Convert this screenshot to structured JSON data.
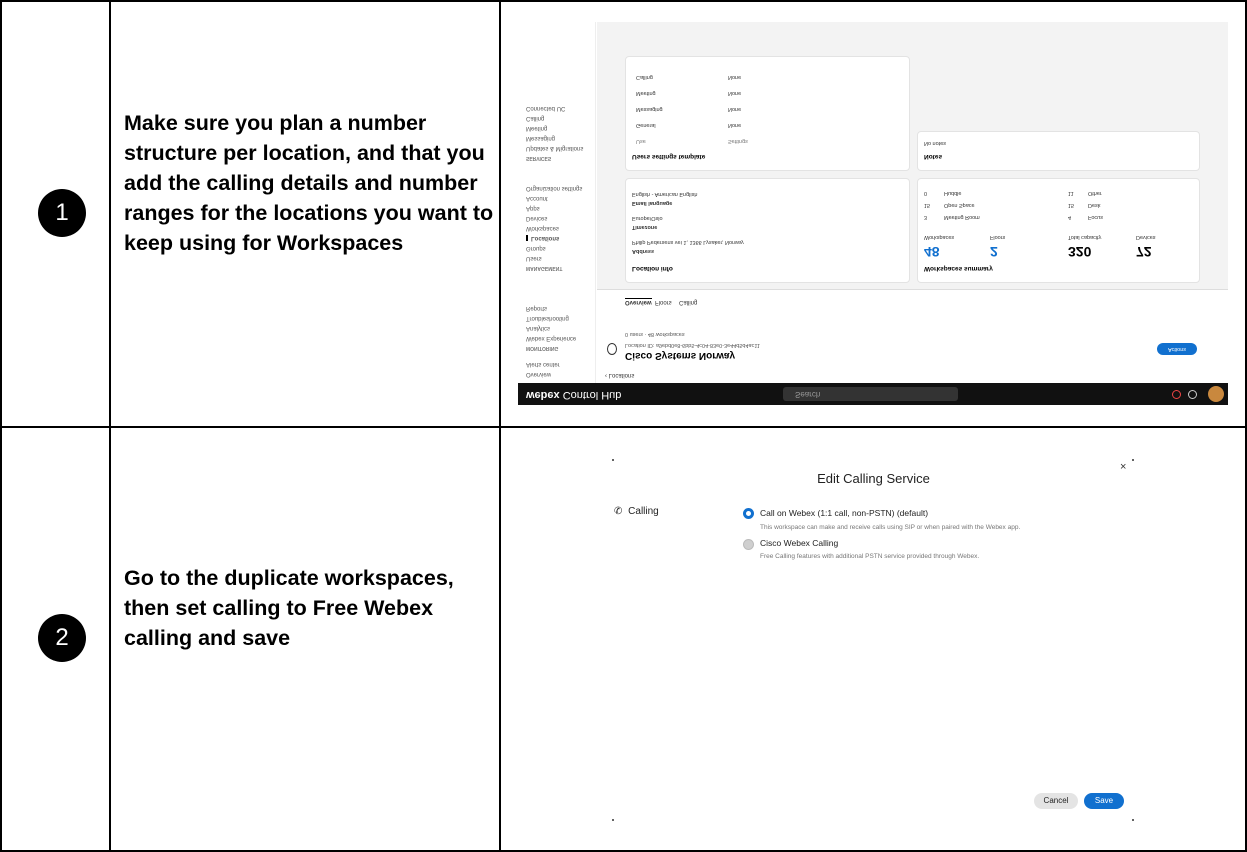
{
  "steps": [
    {
      "number": "1",
      "text": "Make sure you plan a number structure per location, and that you add the calling details and number ranges for the locations you want to keep using for Workspaces"
    },
    {
      "number": "2",
      "text": "Go to the duplicate workspaces, then set calling to Free Webex calling and save"
    }
  ],
  "control_hub": {
    "brand": "webex",
    "brand_product": "Control Hub",
    "search_placeholder": "Search",
    "back_link": "Locations",
    "location_name": "Cisco Systems Norway",
    "location_id": "Location ID: a9ebd0e8-6bb5-4c04-83e0-3e44d5d4ac11",
    "location_counts": "0 users · 48 workspaces",
    "actions_button": "Actions",
    "tabs": [
      "Overview",
      "Floors",
      "Calling"
    ],
    "sidebar": {
      "overview_head": "",
      "items_top": [
        "Overview",
        "Alerts center"
      ],
      "monitoring_head": "MONITORING",
      "monitoring_items": [
        "Webex Experience",
        "Analytics",
        "Troubleshooting",
        "Reports"
      ],
      "management_head": "MANAGEMENT",
      "management_items": [
        "Users",
        "Groups",
        "Locations",
        "Workspaces",
        "Devices",
        "Apps",
        "Account",
        "Organization settings"
      ],
      "services_head": "SERVICES",
      "services_items": [
        "Updates & Migrations",
        "Messaging",
        "Meeting",
        "Calling",
        "Connected UC"
      ]
    },
    "location_info": {
      "title": "Location info",
      "address_label": "Address",
      "address_value": "Philip Pedersens vei 1, 1366 Lysaker, Norway",
      "timezone_label": "Timezone",
      "timezone_value": "Europe/Oslo",
      "email_lang_label": "Email language",
      "email_lang_value": "English - American English"
    },
    "workspaces_summary": {
      "title": "Workspaces summary",
      "stats": [
        {
          "label": "Workspaces",
          "value": "48"
        },
        {
          "label": "Floors",
          "value": "2"
        },
        {
          "label": "Total capacity",
          "value": "320"
        },
        {
          "label": "Devices",
          "value": "72"
        }
      ],
      "breakdown": [
        {
          "count": "3",
          "label": "Meeting Room"
        },
        {
          "count": "15",
          "label": "Open Space"
        },
        {
          "count": "0",
          "label": "Huddle"
        },
        {
          "count": "4",
          "label": "Focus"
        },
        {
          "count": "15",
          "label": "Desk"
        },
        {
          "count": "11",
          "label": "Other"
        }
      ]
    },
    "notes": {
      "title": "Notes",
      "value": "No notes"
    },
    "user_settings": {
      "title": "Users settings template",
      "col1": "Use",
      "col2": "Settings",
      "rows": [
        {
          "name": "General",
          "value": "None"
        },
        {
          "name": "Messaging",
          "value": "None"
        },
        {
          "name": "Meeting",
          "value": "None"
        },
        {
          "name": "Calling",
          "value": "None"
        }
      ]
    }
  },
  "edit_calling": {
    "title": "Edit Calling Service",
    "close": "×",
    "section_label": "Calling",
    "options": [
      {
        "label": "Call on Webex (1:1 call, non-PSTN) (default)",
        "description": "This workspace can make and receive calls using SIP or when paired with the Webex app.",
        "selected": true
      },
      {
        "label": "Cisco Webex Calling",
        "description": "Free Calling features with additional PSTN service provided through Webex.",
        "selected": false
      }
    ],
    "cancel": "Cancel",
    "save": "Save",
    "colors": {
      "accent": "#1170cf"
    }
  }
}
